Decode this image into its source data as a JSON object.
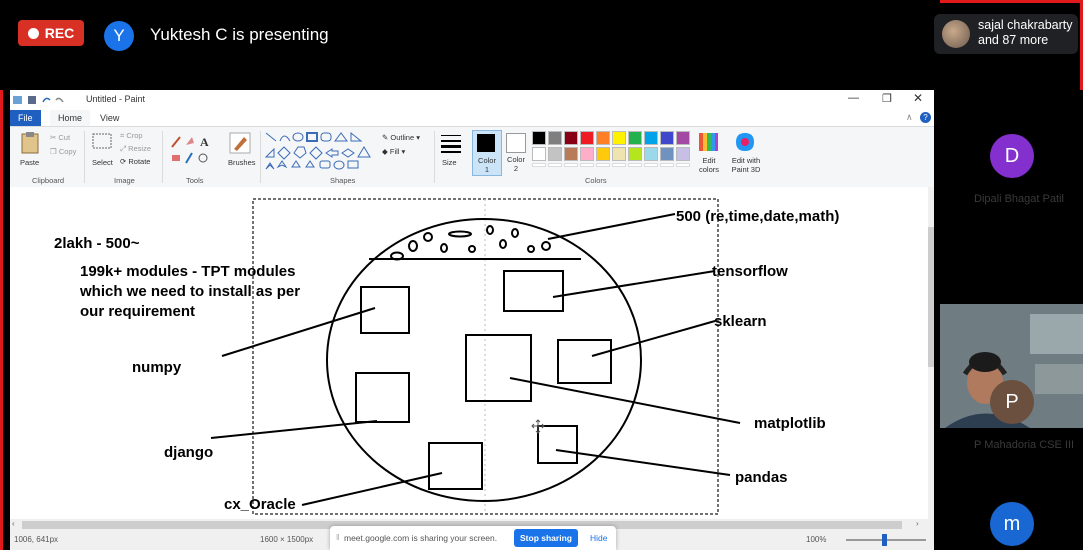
{
  "meet": {
    "rec_label": "REC",
    "presenter_initial": "Y",
    "presenter_text": "Yuktesh C is presenting",
    "participants_text": "sajal chakrabarty and 87 more",
    "share_text": "meet.google.com is sharing your screen.",
    "stop_sharing": "Stop sharing",
    "hide": "Hide"
  },
  "sidebar": {
    "tiles": [
      {
        "initial": "D",
        "color": "#8430ce",
        "name": "Dipali Bhagat Patil"
      },
      {
        "initial": "P",
        "color": "#6b4f3f",
        "name": "P Mahadoria CSE III"
      },
      {
        "initial": "m",
        "color": "#1967d2",
        "name": ""
      }
    ]
  },
  "paint": {
    "title": "Untitled - Paint",
    "tabs": [
      "File",
      "Home",
      "View"
    ],
    "clipboard": {
      "paste": "Paste",
      "cut": "Cut",
      "copy": "Copy",
      "group": "Clipboard"
    },
    "image": {
      "select": "Select",
      "crop": "Crop",
      "resize": "Resize",
      "rotate": "Rotate",
      "group": "Image"
    },
    "tools": {
      "group": "Tools",
      "brushes": "Brushes"
    },
    "shapes": {
      "group": "Shapes",
      "outline": "Outline",
      "fill": "Fill"
    },
    "size": "Size",
    "color1": "Color 1",
    "color2": "Color 2",
    "colors_group": "Colors",
    "edit_colors": "Edit colors",
    "edit_paint3d": "Edit with Paint 3D",
    "palette_row1": [
      "#000000",
      "#7f7f7f",
      "#880015",
      "#ed1c24",
      "#ff7f27",
      "#fff200",
      "#22b14c",
      "#00a2e8",
      "#3f48cc",
      "#a349a4"
    ],
    "palette_row2": [
      "#ffffff",
      "#c3c3c3",
      "#b97a57",
      "#ffaec9",
      "#ffc90e",
      "#efe4b0",
      "#b5e61d",
      "#99d9ea",
      "#7092be",
      "#c8bfe7"
    ],
    "status_left": "1006, 641px",
    "status_sel": "",
    "status_size": "1600 × 1500px",
    "zoom": "100%"
  },
  "drawing": {
    "note_line1": "2lakh - 500~",
    "note_line2": "199k+ modules - TPT modules",
    "note_line3": "which we need to install as per",
    "note_line4": "our requirement",
    "label_stdlib": "500 (re,time,date,math)",
    "label_tensorflow": "tensorflow",
    "label_sklearn": "sklearn",
    "label_numpy": "numpy",
    "label_matplotlib": "matplotlib",
    "label_django": "django",
    "label_pandas": "pandas",
    "label_cx_oracle": "cx_Oracle"
  }
}
